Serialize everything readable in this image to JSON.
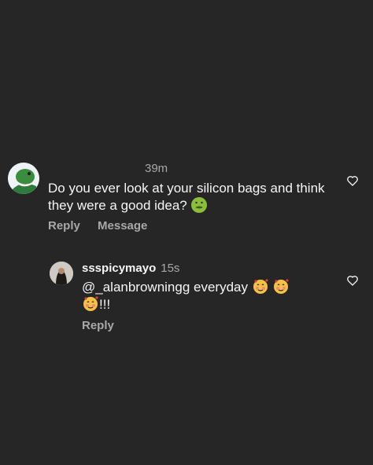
{
  "comments": [
    {
      "time": "39m",
      "text": "Do you ever look at your silicon bags and think they were a good idea?",
      "emoji": "nauseated-face-emoji",
      "actions": {
        "reply": "Reply",
        "message": "Message"
      }
    },
    {
      "username": "ssspicymayo",
      "time": "15s",
      "text_prefix": "@_alanbrowningg everyday",
      "text_suffix": "!!!",
      "emojis": [
        "smiling-face-with-hearts-emoji",
        "smiling-face-with-hearts-emoji",
        "smiling-face-with-hearts-emoji"
      ],
      "actions": {
        "reply": "Reply"
      }
    }
  ],
  "icons": {
    "like": "heart-outline-icon"
  },
  "colors": {
    "background": "#262626",
    "text": "#f5f5f5",
    "secondary": "#a8a8a8"
  }
}
